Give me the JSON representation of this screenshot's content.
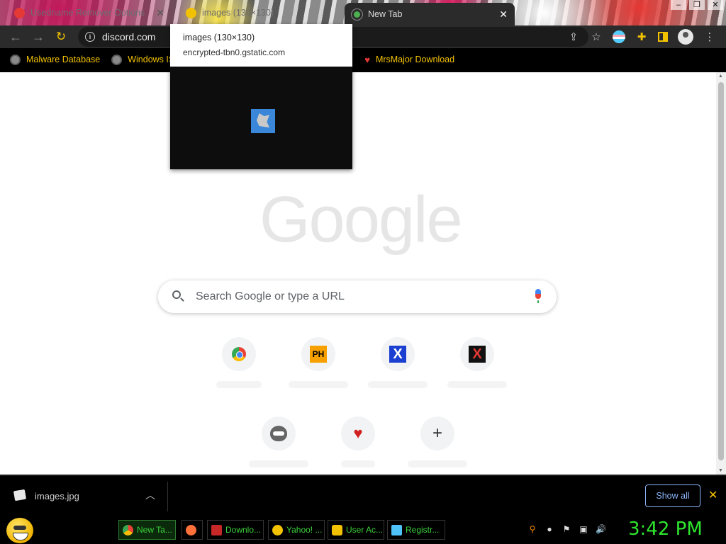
{
  "tabs": [
    {
      "title": "Usedname Remover Options",
      "favicon_color": "#e53935"
    },
    {
      "title": "images (130×130)",
      "favicon_color": "#f2c200"
    },
    {
      "title": "New Tab",
      "favicon_color": "#4caf50",
      "active": true
    }
  ],
  "toolbar": {
    "url": "discord.com",
    "info_glyph": "i",
    "icons": [
      "share-icon",
      "star-icon",
      "flag-extension-icon",
      "puzzle-icon",
      "side-panel-icon",
      "profile-icon",
      "menu-icon"
    ]
  },
  "bookmarks": [
    {
      "label": "Malware Database",
      "icon": "globe-icon"
    },
    {
      "label": "Windows IS",
      "icon": "globe-icon"
    },
    {
      "label": "MrsMajor Download",
      "icon": "heart-icon"
    }
  ],
  "hovercard": {
    "title": "images (130×130)",
    "domain": "encrypted-tbn0.gstatic.com"
  },
  "newtab": {
    "logo": "Google",
    "search_placeholder": "Search Google or type a URL",
    "shortcuts": [
      {
        "name": "chrome-shortcut",
        "icon": "chrome-icon"
      },
      {
        "name": "ph-shortcut",
        "icon": "ph-icon",
        "text": "PH"
      },
      {
        "name": "x-blue-shortcut",
        "icon": "x-blue-icon",
        "text": "X"
      },
      {
        "name": "x-red-shortcut",
        "icon": "x-red-icon",
        "text": "X"
      },
      {
        "name": "raccoon-shortcut",
        "icon": "raccoon-icon"
      },
      {
        "name": "heart-shortcut",
        "icon": "heart-icon",
        "text": "♥"
      },
      {
        "name": "add-shortcut",
        "icon": "plus-icon",
        "text": "+"
      }
    ]
  },
  "downloads": {
    "filename": "images.jpg",
    "show_all": "Show all"
  },
  "taskbar": {
    "items": [
      {
        "label": "New Ta...",
        "icon_color": "#4285f4",
        "active": true
      },
      {
        "label": "",
        "icon_color": "#ff7139"
      },
      {
        "label": "Downlo...",
        "icon_color": "#c62828"
      },
      {
        "label": "Yahoo! ...",
        "icon_color": "#f2c200"
      },
      {
        "label": "User Ac...",
        "icon_color": "#f2c200"
      },
      {
        "label": "Registr...",
        "icon_color": "#4fc3f7"
      }
    ],
    "clock": "3:42 PM"
  },
  "colors": {
    "accent_yellow": "#f2c200",
    "taskbar_green": "#2ee62e",
    "link_blue": "#8ab4f8"
  }
}
